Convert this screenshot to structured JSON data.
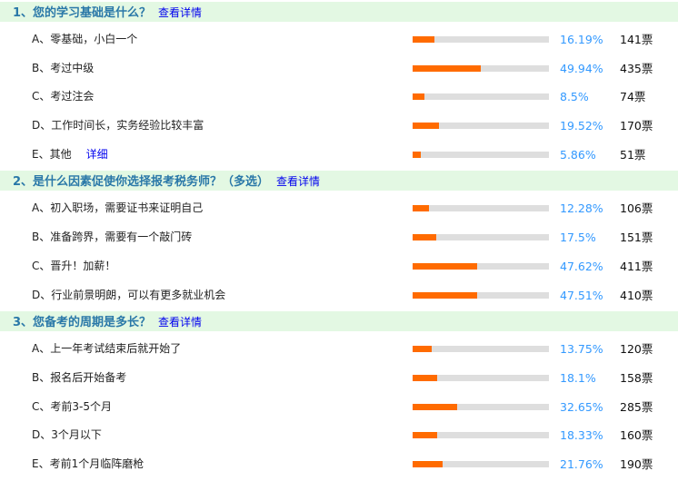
{
  "colors": {
    "fill": "#ff6b00",
    "track": "#dedede",
    "header_bg": "#e3f8e3",
    "title": "#2a78a8",
    "link": "#0000ee",
    "percent": "#3399ff"
  },
  "sections": [
    {
      "title": "1、您的学习基础是什么？",
      "link": "查看详情",
      "options": [
        {
          "label": "A、零基础，小白一个",
          "percent": "16.19%",
          "value": 16.19,
          "votes": "141票"
        },
        {
          "label": "B、考过中级",
          "percent": "49.94%",
          "value": 49.94,
          "votes": "435票"
        },
        {
          "label": "C、考过注会",
          "percent": "8.5%",
          "value": 8.5,
          "votes": "74票"
        },
        {
          "label": "D、工作时间长，实务经验比较丰富",
          "percent": "19.52%",
          "value": 19.52,
          "votes": "170票"
        },
        {
          "label": "E、其他",
          "detail": "详细",
          "percent": "5.86%",
          "value": 5.86,
          "votes": "51票"
        }
      ]
    },
    {
      "title": "2、是什么因素促使你选择报考税务师？（多选）",
      "link": "查看详情",
      "options": [
        {
          "label": "A、初入职场，需要证书来证明自己",
          "percent": "12.28%",
          "value": 12.28,
          "votes": "106票"
        },
        {
          "label": "B、准备跨界，需要有一个敲门砖",
          "percent": "17.5%",
          "value": 17.5,
          "votes": "151票"
        },
        {
          "label": "C、晋升！加薪！",
          "percent": "47.62%",
          "value": 47.62,
          "votes": "411票"
        },
        {
          "label": "D、行业前景明朗，可以有更多就业机会",
          "percent": "47.51%",
          "value": 47.51,
          "votes": "410票"
        }
      ]
    },
    {
      "title": "3、您备考的周期是多长？",
      "link": "查看详情",
      "options": [
        {
          "label": "A、上一年考试结束后就开始了",
          "percent": "13.75%",
          "value": 13.75,
          "votes": "120票"
        },
        {
          "label": "B、报名后开始备考",
          "percent": "18.1%",
          "value": 18.1,
          "votes": "158票"
        },
        {
          "label": "C、考前3-5个月",
          "percent": "32.65%",
          "value": 32.65,
          "votes": "285票"
        },
        {
          "label": "D、3个月以下",
          "percent": "18.33%",
          "value": 18.33,
          "votes": "160票"
        },
        {
          "label": "E、考前1个月临阵磨枪",
          "percent": "21.76%",
          "value": 21.76,
          "votes": "190票"
        }
      ]
    }
  ]
}
